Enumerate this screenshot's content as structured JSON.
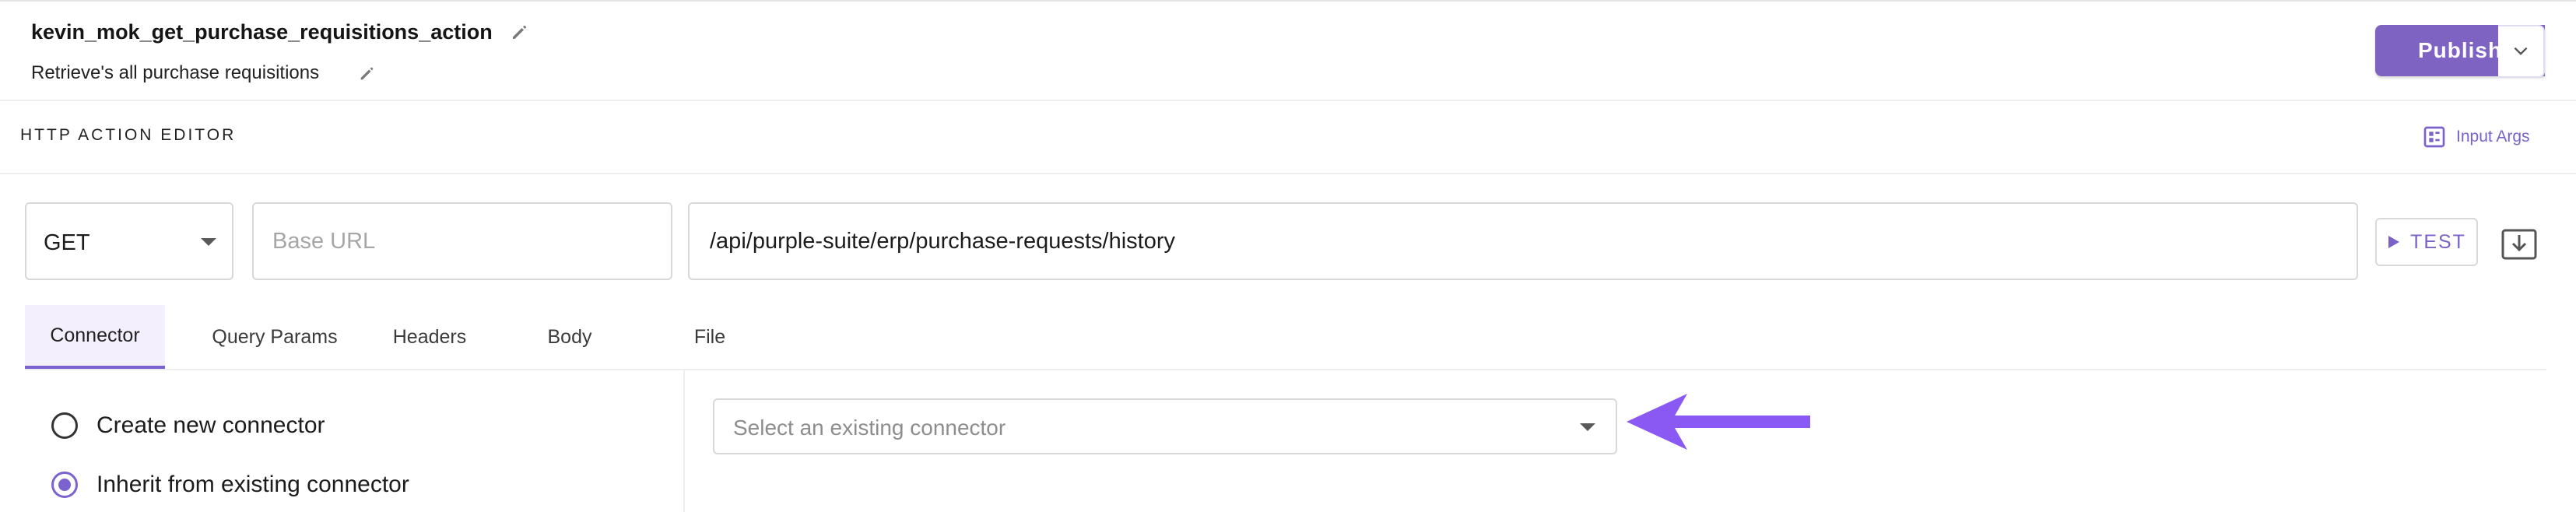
{
  "header": {
    "title": "kevin_mok_get_purchase_requisitions_action",
    "subtitle": "Retrieve's all purchase requisitions",
    "publish_label": "Publish"
  },
  "section": {
    "title": "HTTP ACTION EDITOR",
    "input_args_label": "Input Args"
  },
  "request": {
    "method": "GET",
    "base_url_placeholder": "Base URL",
    "path_value": "/api/purple-suite/erp/purchase-requests/history",
    "test_label": "TEST"
  },
  "tabs": [
    {
      "label": "Connector",
      "active": true
    },
    {
      "label": "Query Params",
      "active": false
    },
    {
      "label": "Headers",
      "active": false
    },
    {
      "label": "Body",
      "active": false
    },
    {
      "label": "File",
      "active": false
    }
  ],
  "connector": {
    "options": [
      {
        "label": "Create new connector",
        "checked": false
      },
      {
        "label": "Inherit from existing connector",
        "checked": true
      }
    ],
    "select_placeholder": "Select an existing connector"
  },
  "icons": {
    "title_edit": "pencil-icon",
    "subtitle_edit": "pencil-icon",
    "publish_menu": "chevron-down-icon",
    "input_args": "input-args-icon",
    "test": "play-icon",
    "save": "download-box-icon",
    "annotation": "arrow-left-icon"
  },
  "colors": {
    "accent": "#7e63c2",
    "annotation_arrow": "#8a58f2",
    "active_tab_bg": "#f3effc"
  }
}
